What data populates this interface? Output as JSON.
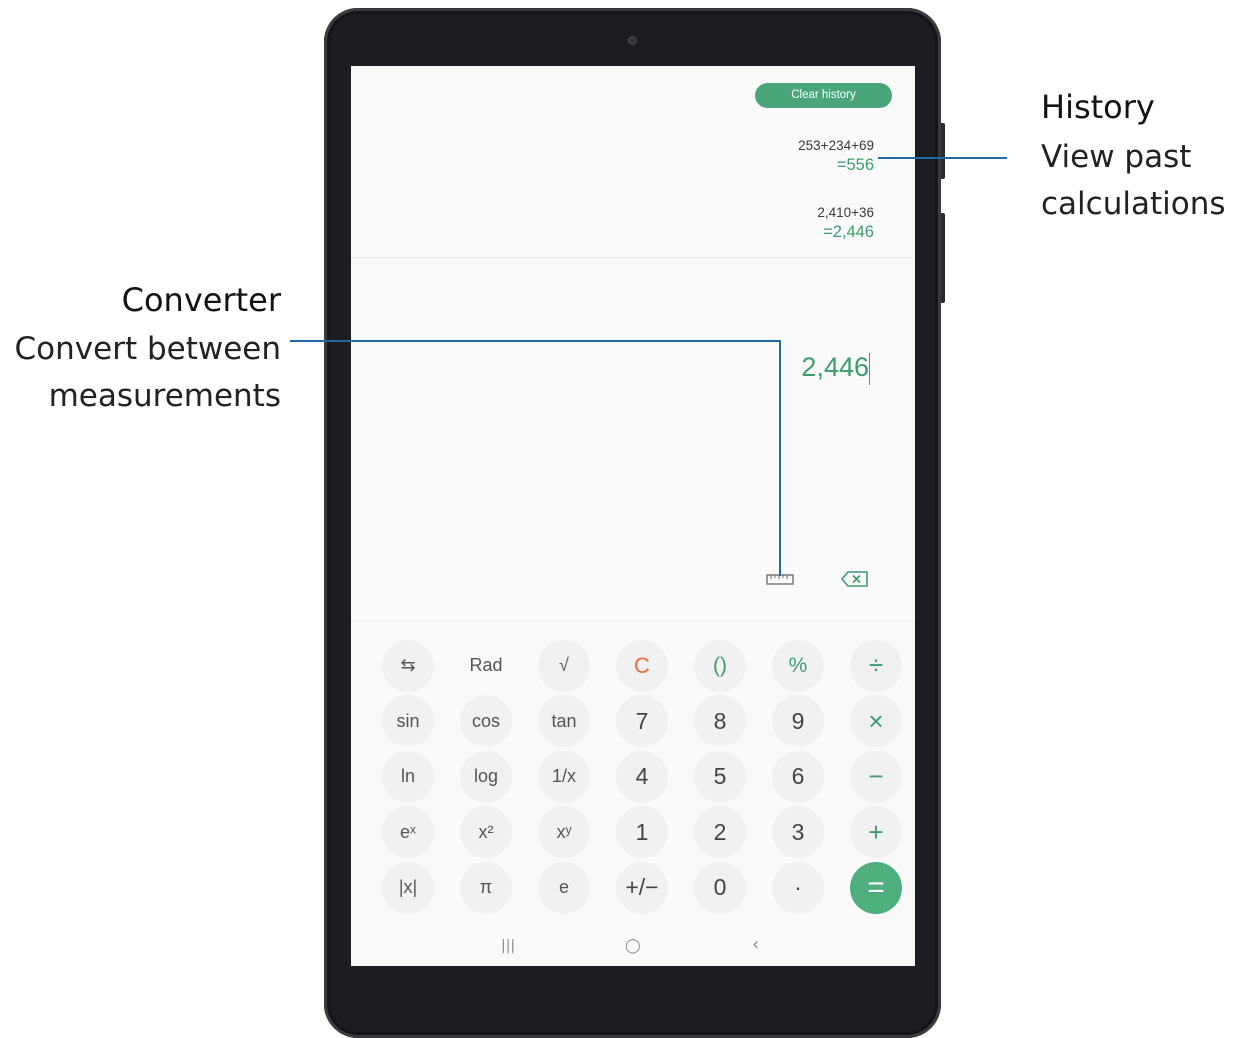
{
  "screen": {
    "clear_history_label": "Clear history",
    "history": [
      {
        "expression": "253+234+69",
        "result": "=556"
      },
      {
        "expression": "2,410+36",
        "result": "=2,446"
      }
    ],
    "display_value": "2,446",
    "icons": {
      "converter": "ruler-icon",
      "backspace": "backspace-icon"
    },
    "colors": {
      "accent": "#4aa57a",
      "clear": "#ef6a3f",
      "callout_line": "#1f6aa6"
    }
  },
  "keypad": [
    [
      "⇆",
      "Rad",
      "√",
      "C",
      "()",
      "%",
      "÷"
    ],
    [
      "sin",
      "cos",
      "tan",
      "7",
      "8",
      "9",
      "×"
    ],
    [
      "ln",
      "log",
      "1/x",
      "4",
      "5",
      "6",
      "−"
    ],
    [
      "eˣ",
      "x²",
      "xʸ",
      "1",
      "2",
      "3",
      "+"
    ],
    [
      "|x|",
      "π",
      "e",
      "+/−",
      "0",
      "·",
      "="
    ]
  ],
  "nav": {
    "recents": "|||",
    "home": "◯",
    "back": "‹"
  },
  "callouts": {
    "history": {
      "title": "History",
      "line1": "View past",
      "line2": "calculations"
    },
    "converter": {
      "title": "Converter",
      "line1": "Convert between",
      "line2": "measurements"
    }
  }
}
